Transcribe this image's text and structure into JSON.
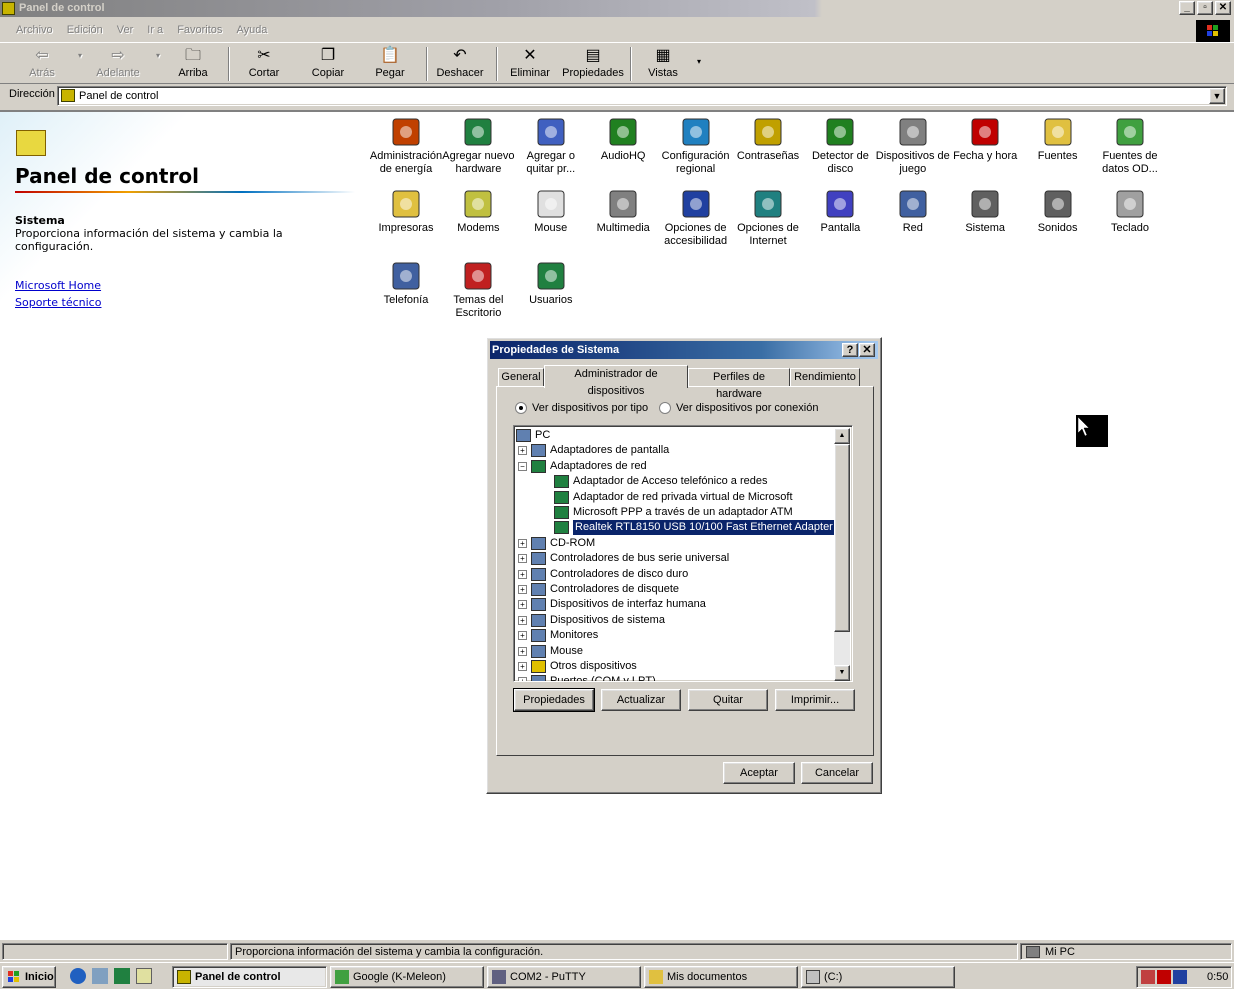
{
  "window": {
    "title": "Panel de control"
  },
  "menu": [
    "Archivo",
    "Edición",
    "Ver",
    "Ir a",
    "Favoritos",
    "Ayuda"
  ],
  "toolbar": {
    "back": "Atrás",
    "forward": "Adelante",
    "up": "Arriba",
    "cut": "Cortar",
    "copy": "Copiar",
    "paste": "Pegar",
    "undo": "Deshacer",
    "delete": "Eliminar",
    "properties": "Propiedades",
    "views": "Vistas"
  },
  "address": {
    "label": "Dirección",
    "value": "Panel de control"
  },
  "leftpane": {
    "title": "Panel de control",
    "selected_name": "Sistema",
    "selected_desc": "Proporciona información del sistema y cambia la configuración.",
    "link1": "Microsoft Home",
    "link2": "Soporte técnico"
  },
  "icons": [
    {
      "label": "Administración de energía",
      "icon": "power-icon",
      "color": "#c04000"
    },
    {
      "label": "Agregar nuevo hardware",
      "icon": "add-hardware-icon",
      "color": "#208040"
    },
    {
      "label": "Agregar o quitar pr...",
      "icon": "add-remove-programs-icon",
      "color": "#4060c0"
    },
    {
      "label": "AudioHQ",
      "icon": "audiohq-icon",
      "color": "#208020"
    },
    {
      "label": "Configuración regional",
      "icon": "globe-icon",
      "color": "#2080c0"
    },
    {
      "label": "Contraseñas",
      "icon": "keys-icon",
      "color": "#c0a000"
    },
    {
      "label": "Detector de disco",
      "icon": "disc-detector-icon",
      "color": "#208020"
    },
    {
      "label": "Dispositivos de juego",
      "icon": "joystick-icon",
      "color": "#808080"
    },
    {
      "label": "Fecha y hora",
      "icon": "clock-icon",
      "color": "#c00000"
    },
    {
      "label": "Fuentes",
      "icon": "fonts-icon",
      "color": "#e0c040"
    },
    {
      "label": "Fuentes de datos OD...",
      "icon": "odbc-icon",
      "color": "#40a040"
    },
    {
      "label": "Impresoras",
      "icon": "printers-icon",
      "color": "#e0c040"
    },
    {
      "label": "Modems",
      "icon": "modem-icon",
      "color": "#c0c040"
    },
    {
      "label": "Mouse",
      "icon": "mouse-icon",
      "color": "#e0e0e0"
    },
    {
      "label": "Multimedia",
      "icon": "multimedia-icon",
      "color": "#808080"
    },
    {
      "label": "Opciones de accesibilidad",
      "icon": "accessibility-icon",
      "color": "#2040a0"
    },
    {
      "label": "Opciones de Internet",
      "icon": "internet-options-icon",
      "color": "#208080"
    },
    {
      "label": "Pantalla",
      "icon": "display-icon",
      "color": "#4040c0"
    },
    {
      "label": "Red",
      "icon": "network-icon",
      "color": "#4060a0"
    },
    {
      "label": "Sistema",
      "icon": "computer-icon",
      "color": "#606060"
    },
    {
      "label": "Sonidos",
      "icon": "speaker-icon",
      "color": "#606060"
    },
    {
      "label": "Teclado",
      "icon": "keyboard-icon",
      "color": "#a0a0a0"
    },
    {
      "label": "Telefonía",
      "icon": "telephony-icon",
      "color": "#4060a0"
    },
    {
      "label": "Temas del Escritorio",
      "icon": "themes-icon",
      "color": "#c02020"
    },
    {
      "label": "Usuarios",
      "icon": "users-icon",
      "color": "#208040"
    }
  ],
  "dialog": {
    "title": "Propiedades de Sistema",
    "help": "?",
    "close": "✕",
    "tabs": [
      "General",
      "Administrador de dispositivos",
      "Perfiles de hardware",
      "Rendimiento"
    ],
    "radio_type": "Ver dispositivos por tipo",
    "radio_connection": "Ver dispositivos por conexión",
    "tree": [
      {
        "label": "PC",
        "level": 0,
        "exp": "",
        "icon": "computer-icon"
      },
      {
        "label": "Adaptadores de pantalla",
        "level": 1,
        "exp": "+",
        "icon": "display-adapter-icon"
      },
      {
        "label": "Adaptadores de red",
        "level": 1,
        "exp": "−",
        "icon": "network-card-icon"
      },
      {
        "label": "Adaptador de Acceso telefónico a redes",
        "level": 2,
        "exp": "",
        "icon": "network-card-icon"
      },
      {
        "label": "Adaptador de red privada virtual de Microsoft",
        "level": 2,
        "exp": "",
        "icon": "network-card-icon"
      },
      {
        "label": "Microsoft PPP a través de un adaptador ATM",
        "level": 2,
        "exp": "",
        "icon": "network-card-icon"
      },
      {
        "label": "Realtek RTL8150 USB 10/100 Fast Ethernet Adapter",
        "level": 2,
        "exp": "",
        "icon": "network-card-icon",
        "selected": true
      },
      {
        "label": "CD-ROM",
        "level": 1,
        "exp": "+",
        "icon": "cdrom-icon"
      },
      {
        "label": "Controladores de bus serie universal",
        "level": 1,
        "exp": "+",
        "icon": "usb-icon"
      },
      {
        "label": "Controladores de disco duro",
        "level": 1,
        "exp": "+",
        "icon": "hard-disk-icon"
      },
      {
        "label": "Controladores de disquete",
        "level": 1,
        "exp": "+",
        "icon": "floppy-icon"
      },
      {
        "label": "Dispositivos de interfaz humana",
        "level": 1,
        "exp": "+",
        "icon": "hid-icon"
      },
      {
        "label": "Dispositivos de sistema",
        "level": 1,
        "exp": "+",
        "icon": "system-device-icon"
      },
      {
        "label": "Monitores",
        "level": 1,
        "exp": "+",
        "icon": "monitor-icon"
      },
      {
        "label": "Mouse",
        "level": 1,
        "exp": "+",
        "icon": "mouse-icon"
      },
      {
        "label": "Otros dispositivos",
        "level": 1,
        "exp": "+",
        "icon": "question-icon"
      },
      {
        "label": "Puertos (COM y LPT)",
        "level": 1,
        "exp": "+",
        "icon": "port-icon"
      }
    ],
    "btn_properties": "Propiedades",
    "btn_refresh": "Actualizar",
    "btn_remove": "Quitar",
    "btn_print": "Imprimir...",
    "btn_ok": "Aceptar",
    "btn_cancel": "Cancelar"
  },
  "status": {
    "text": "Proporciona información del sistema y cambia la configuración.",
    "zone": "Mi PC"
  },
  "taskbar": {
    "start": "Inicio",
    "tasks": [
      "Panel de control",
      "Google (K-Meleon)",
      "COM2 - PuTTY",
      "Mis documentos",
      "(C:)"
    ],
    "clock": "0:50"
  }
}
